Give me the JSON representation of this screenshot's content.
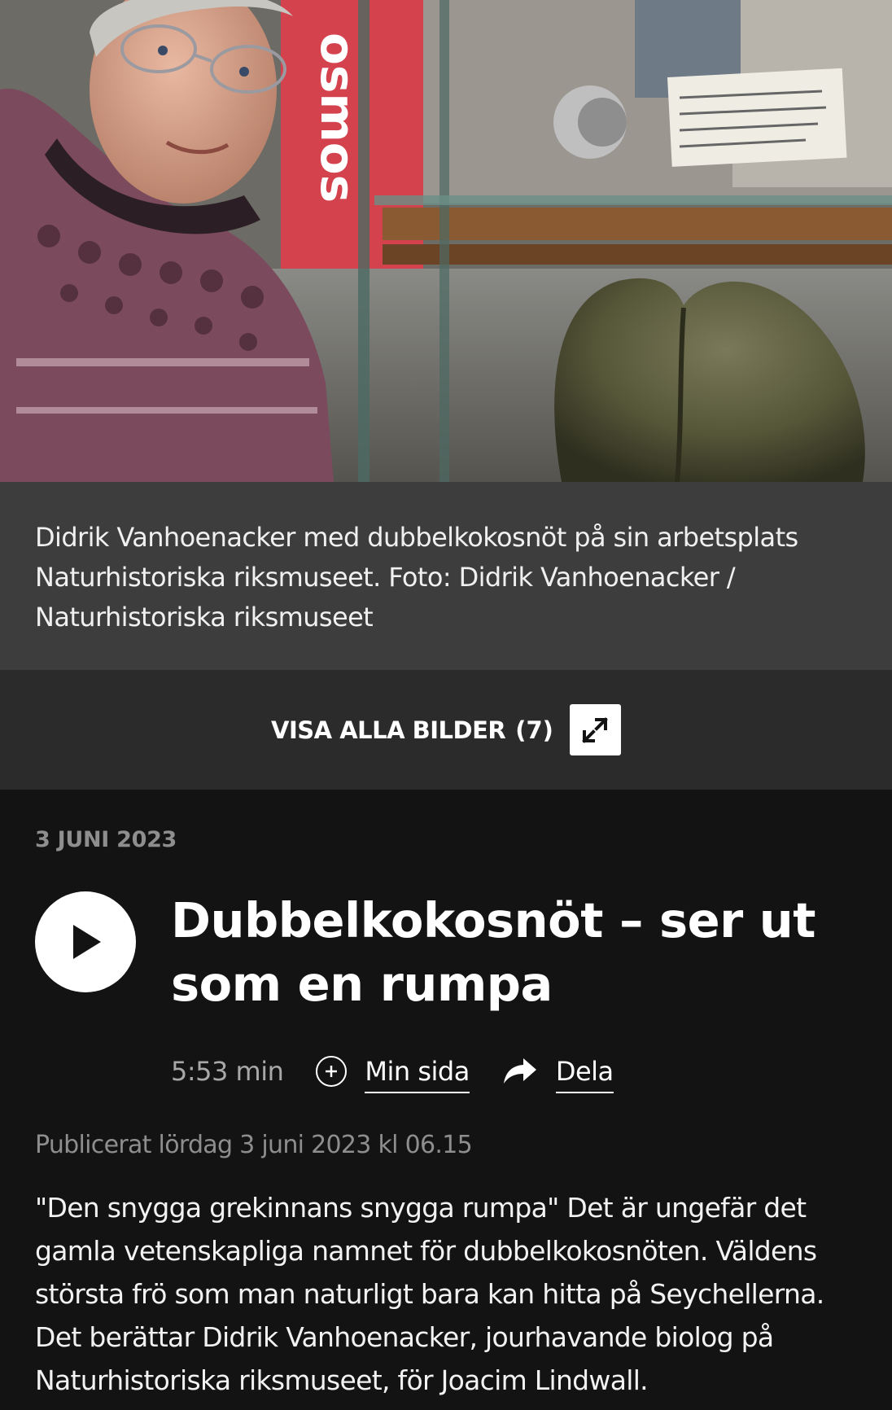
{
  "photo": {
    "alt_icon": "photo-image",
    "sign_text": "osmos"
  },
  "caption": {
    "text": "Didrik Vanhoenacker med dubbelkokosnöt på sin arbetsplats Naturhistoriska riksmuseet. Foto: Didrik Vanhoenacker / Naturhistoriska riksmuseet"
  },
  "gallery": {
    "label": "VISA ALLA BILDER",
    "count": "(7)",
    "icon": "expand-icon"
  },
  "article": {
    "date": "3 JUNI 2023",
    "title": "Dubbelkokosnöt – ser ut som en rumpa",
    "duration": "5:53 min",
    "my_page_label": "Min sida",
    "share_label": "Dela",
    "published": "Publicerat lördag 3 juni 2023 kl 06.15",
    "body": "\"Den snygga grekinnans snygga rumpa\" Det är ungefär det gamla vetenskapliga namnet för dubbelkokosnöten. Väldens största frö som man naturligt bara kan hitta på Seychellerna. Det berättar Didrik Vanhoenacker, jourhavande biolog på Naturhistoriska riksmuseet, för Joacim Lindwall."
  },
  "colors": {
    "background": "#131313",
    "caption_bg": "#3d3d3d",
    "gallery_bg": "#2b2b2b",
    "muted_text": "#8e8e8e"
  }
}
